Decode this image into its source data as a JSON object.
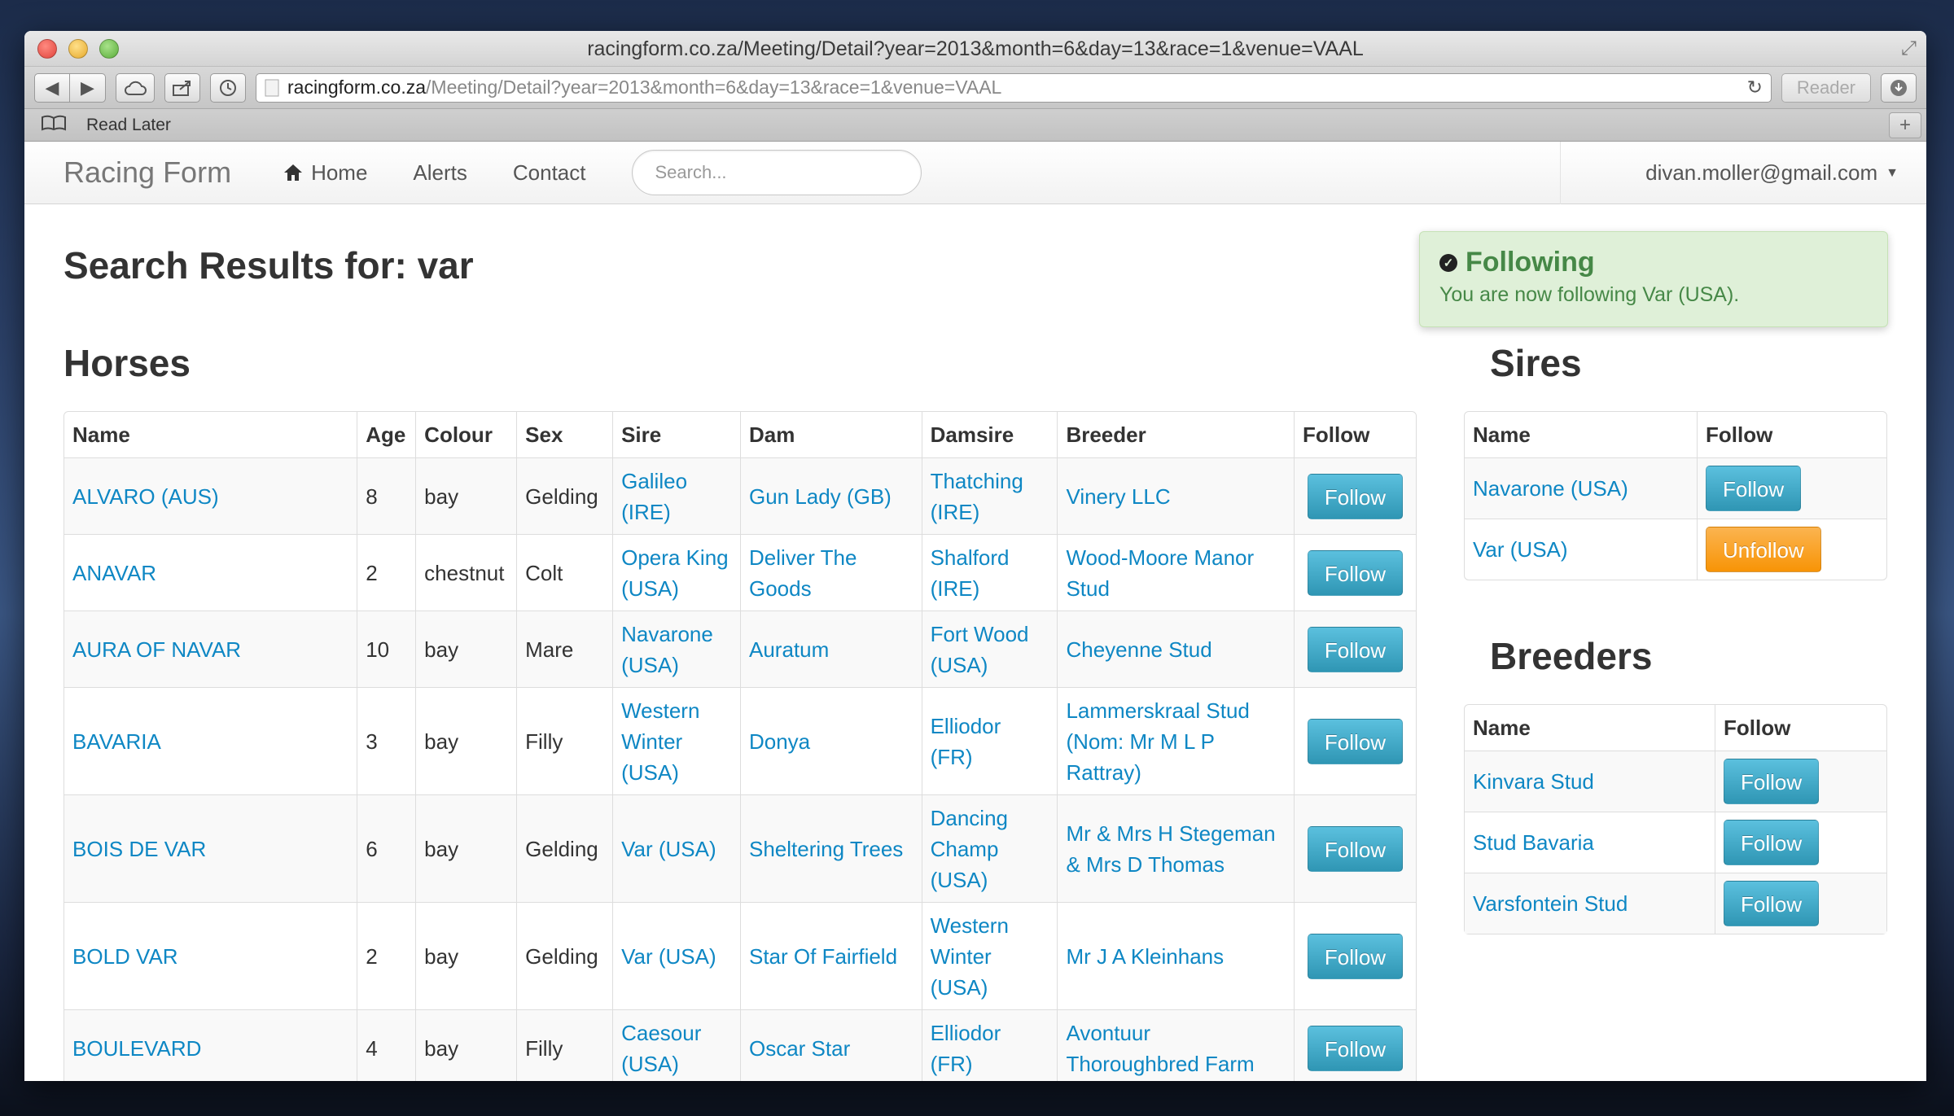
{
  "window": {
    "title": "racingform.co.za/Meeting/Detail?year=2013&month=6&day=13&race=1&venue=VAAL",
    "url_host": "racingform.co.za",
    "url_path": "/Meeting/Detail?year=2013&month=6&day=13&race=1&venue=VAAL",
    "reader_label": "Reader",
    "bookmark_label": "Read Later"
  },
  "navbar": {
    "brand": "Racing Form",
    "home": "Home",
    "alerts": "Alerts",
    "contact": "Contact",
    "search_placeholder": "Search...",
    "user": "divan.moller@gmail.com"
  },
  "alert": {
    "title": "Following",
    "text": "You are now following Var (USA)."
  },
  "page_title": "Search Results for: var",
  "horses": {
    "heading": "Horses",
    "columns": [
      "Name",
      "Age",
      "Colour",
      "Sex",
      "Sire",
      "Dam",
      "Damsire",
      "Breeder",
      "Follow"
    ],
    "rows": [
      {
        "name": "ALVARO (AUS)",
        "age": "8",
        "colour": "bay",
        "sex": "Gelding",
        "sire": "Galileo (IRE)",
        "dam": "Gun Lady (GB)",
        "damsire": "Thatching (IRE)",
        "breeder": "Vinery LLC",
        "action": "Follow"
      },
      {
        "name": "ANAVAR",
        "age": "2",
        "colour": "chestnut",
        "sex": "Colt",
        "sire": "Opera King (USA)",
        "dam": "Deliver The Goods",
        "damsire": "Shalford (IRE)",
        "breeder": "Wood-Moore Manor Stud",
        "action": "Follow"
      },
      {
        "name": "AURA OF NAVAR",
        "age": "10",
        "colour": "bay",
        "sex": "Mare",
        "sire": "Navarone (USA)",
        "dam": "Auratum",
        "damsire": "Fort Wood (USA)",
        "breeder": "Cheyenne Stud",
        "action": "Follow"
      },
      {
        "name": "BAVARIA",
        "age": "3",
        "colour": "bay",
        "sex": "Filly",
        "sire": "Western Winter (USA)",
        "dam": "Donya",
        "damsire": "Elliodor (FR)",
        "breeder": "Lammerskraal Stud (Nom: Mr M L P Rattray)",
        "action": "Follow"
      },
      {
        "name": "BOIS DE VAR",
        "age": "6",
        "colour": "bay",
        "sex": "Gelding",
        "sire": "Var (USA)",
        "dam": "Sheltering Trees",
        "damsire": "Dancing Champ (USA)",
        "breeder": "Mr & Mrs H Stegeman & Mrs D Thomas",
        "action": "Follow"
      },
      {
        "name": "BOLD VAR",
        "age": "2",
        "colour": "bay",
        "sex": "Gelding",
        "sire": "Var (USA)",
        "dam": "Star Of Fairfield",
        "damsire": "Western Winter (USA)",
        "breeder": "Mr J A Kleinhans",
        "action": "Follow"
      },
      {
        "name": "BOULEVARD",
        "age": "4",
        "colour": "bay",
        "sex": "Filly",
        "sire": "Caesour (USA)",
        "dam": "Oscar Star",
        "damsire": "Elliodor (FR)",
        "breeder": "Avontuur Thoroughbred Farm",
        "action": "Follow"
      }
    ]
  },
  "sires": {
    "heading": "Sires",
    "columns": [
      "Name",
      "Follow"
    ],
    "rows": [
      {
        "name": "Navarone (USA)",
        "action": "Follow",
        "style": "info"
      },
      {
        "name": "Var (USA)",
        "action": "Unfollow",
        "style": "warning"
      }
    ]
  },
  "breeders": {
    "heading": "Breeders",
    "columns": [
      "Name",
      "Follow"
    ],
    "rows": [
      {
        "name": "Kinvara Stud",
        "action": "Follow",
        "style": "info"
      },
      {
        "name": "Stud Bavaria",
        "action": "Follow",
        "style": "info"
      },
      {
        "name": "Varsfontein Stud",
        "action": "Follow",
        "style": "info"
      }
    ]
  },
  "colors": {
    "link": "#0e87c4",
    "btn_info": "#49afcd",
    "btn_warning": "#f89406",
    "alert_bg": "#dff0d8",
    "alert_text": "#468847"
  }
}
